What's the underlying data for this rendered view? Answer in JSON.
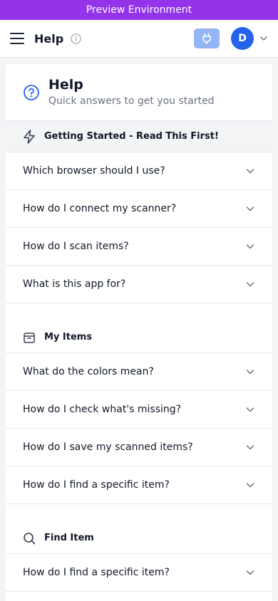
{
  "banner": {
    "text": "Preview Environment"
  },
  "topbar": {
    "title": "Help",
    "avatar_initial": "D"
  },
  "help": {
    "title": "Help",
    "subtitle": "Quick answers to get you started"
  },
  "sections": [
    {
      "title": "Getting Started - Read This First!",
      "icon": "lightning-icon",
      "questions": [
        "Which browser should I use?",
        "How do I connect my scanner?",
        "How do I scan items?",
        "What is this app for?"
      ]
    },
    {
      "title": "My Items",
      "icon": "box-icon",
      "questions": [
        "What do the colors mean?",
        "How do I check what's missing?",
        "How do I save my scanned items?",
        "How do I find a specific item?"
      ]
    },
    {
      "title": "Find Item",
      "icon": "search-icon",
      "questions": [
        "How do I find a specific item?"
      ]
    }
  ],
  "colors": {
    "banner": "#9333ea",
    "accent": "#2563eb",
    "plug_button": "#93b4f5"
  }
}
